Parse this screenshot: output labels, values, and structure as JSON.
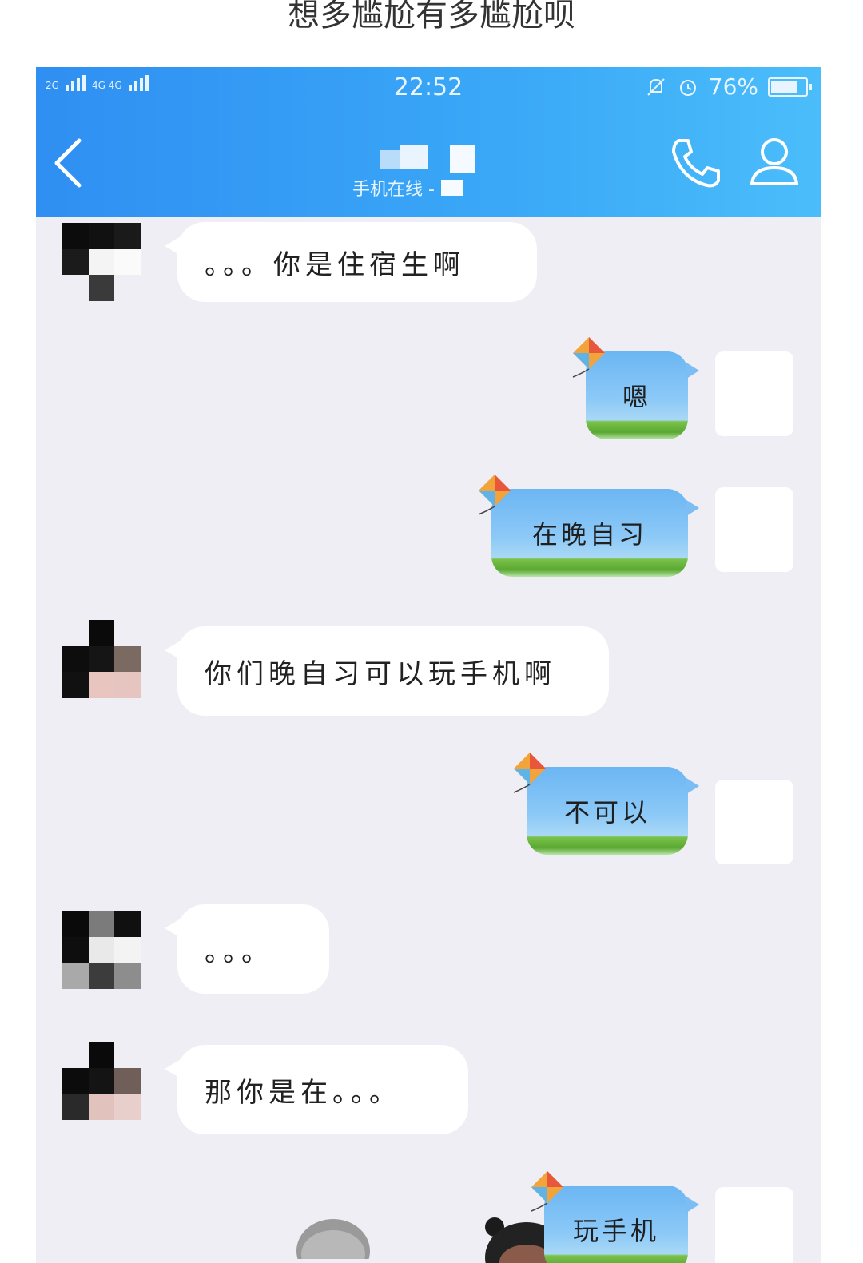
{
  "caption": "想多尴尬有多尴尬呗",
  "status_bar": {
    "network_left": "2G",
    "network_right": "4G 4G",
    "time": "22:52",
    "battery": "76%",
    "battery_level": 0.76
  },
  "header": {
    "subtitle": "手机在线 - "
  },
  "messages": [
    {
      "side": "left",
      "text": "。。。你是住宿生啊"
    },
    {
      "side": "right",
      "text": "嗯"
    },
    {
      "side": "right",
      "text": "在晚自习"
    },
    {
      "side": "left",
      "text": "你们晚自习可以玩手机啊"
    },
    {
      "side": "right",
      "text": "不可以"
    },
    {
      "side": "left",
      "text": "。。。"
    },
    {
      "side": "left",
      "text": "那你是在。。。"
    },
    {
      "side": "right",
      "text": "玩手机"
    }
  ],
  "colors": {
    "header_gradient_start": "#2f8ff2",
    "header_gradient_end": "#4bbdfa",
    "chat_background": "#eeeef4",
    "bubble_left": "#ffffff"
  },
  "icons": {
    "back": "back-chevron-icon",
    "call": "phone-icon",
    "profile": "profile-icon",
    "bubble_decoration": "kite-icon"
  }
}
